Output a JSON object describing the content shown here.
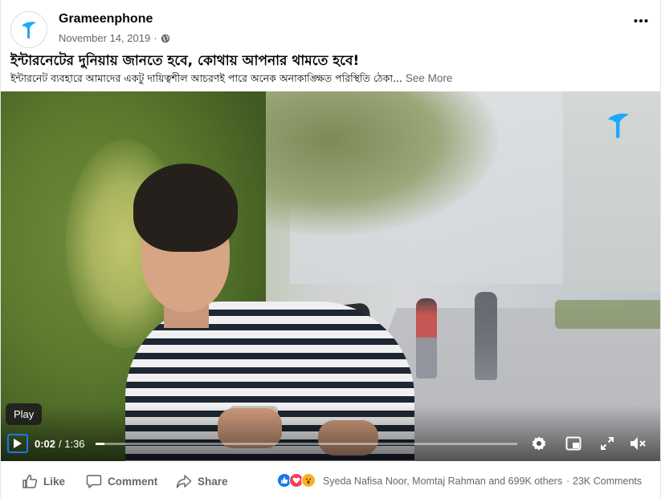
{
  "post": {
    "page_name": "Grameenphone",
    "date": "November 14, 2019",
    "separator": "·",
    "headline": "ইন্টারনেটের দুনিয়ায় জানতে হবে, কোথায় আপনার থামতে হবে!",
    "body": "ইন্টারনেট ব্যবহারে আমাদের একটু দায়িত্বশীল আচরণই পারে অনেক অনাকাঙ্ক্ষিত পরিস্থিতি ঠেকা...",
    "see_more": "See More",
    "icons": {
      "menu": "more-horizontal-icon",
      "audience": "globe-icon",
      "avatar": "grameenphone-logo"
    }
  },
  "video": {
    "tooltip": "Play",
    "current_time": "0:02",
    "duration_text": "/ 1:36",
    "progress": 0.021,
    "controls": [
      "settings-icon",
      "pip-icon",
      "fullscreen-icon",
      "mute-icon"
    ],
    "brand_color": "#1877f2"
  },
  "footer": {
    "like": "Like",
    "comment": "Comment",
    "share": "Share",
    "reaction_names": "Syeda Nafisa Noor, Momtaj Rahman and 699K others",
    "separator": "·",
    "comments_count": "23K Comments",
    "reactions": [
      "like",
      "love",
      "wow"
    ]
  },
  "colors": {
    "accent": "#1877f2",
    "secondary_text": "#65676b",
    "love": "#f33e58",
    "wow": "#f7b125",
    "gp_logo": "#19aaf8"
  }
}
